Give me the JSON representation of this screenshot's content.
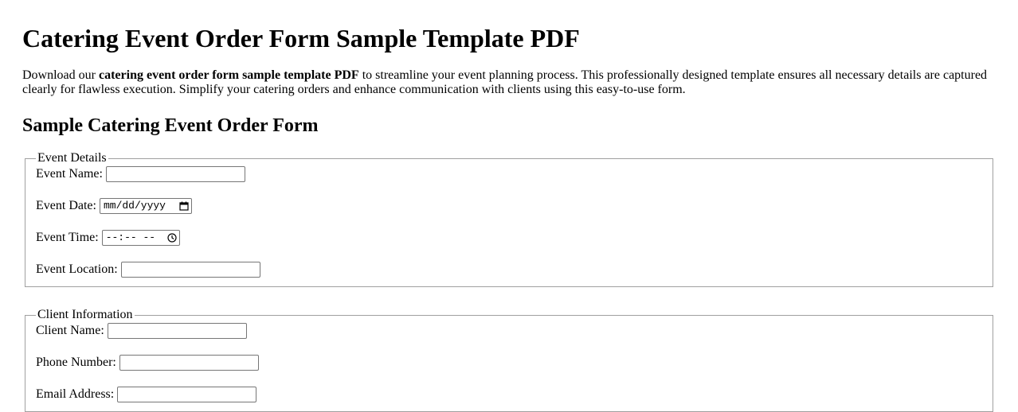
{
  "page": {
    "title": "Catering Event Order Form Sample Template PDF",
    "intro_before": "Download our ",
    "intro_bold": "catering event order form sample template PDF",
    "intro_after": " to streamline your event planning process. This professionally designed template ensures all necessary details are captured clearly for flawless execution. Simplify your catering orders and enhance communication with clients using this easy-to-use form.",
    "section_title": "Sample Catering Event Order Form"
  },
  "event_details": {
    "legend": "Event Details",
    "name_label": "Event Name:",
    "name_value": "",
    "date_label": "Event Date:",
    "date_placeholder": "mm/dd/yyyy",
    "time_label": "Event Time:",
    "time_placeholder": "--:-- --",
    "location_label": "Event Location:",
    "location_value": ""
  },
  "client_info": {
    "legend": "Client Information",
    "name_label": "Client Name:",
    "phone_label": "Phone Number:",
    "email_label": "Email Address:"
  },
  "icons": {
    "date": "calendar-icon",
    "time": "clock-icon"
  }
}
